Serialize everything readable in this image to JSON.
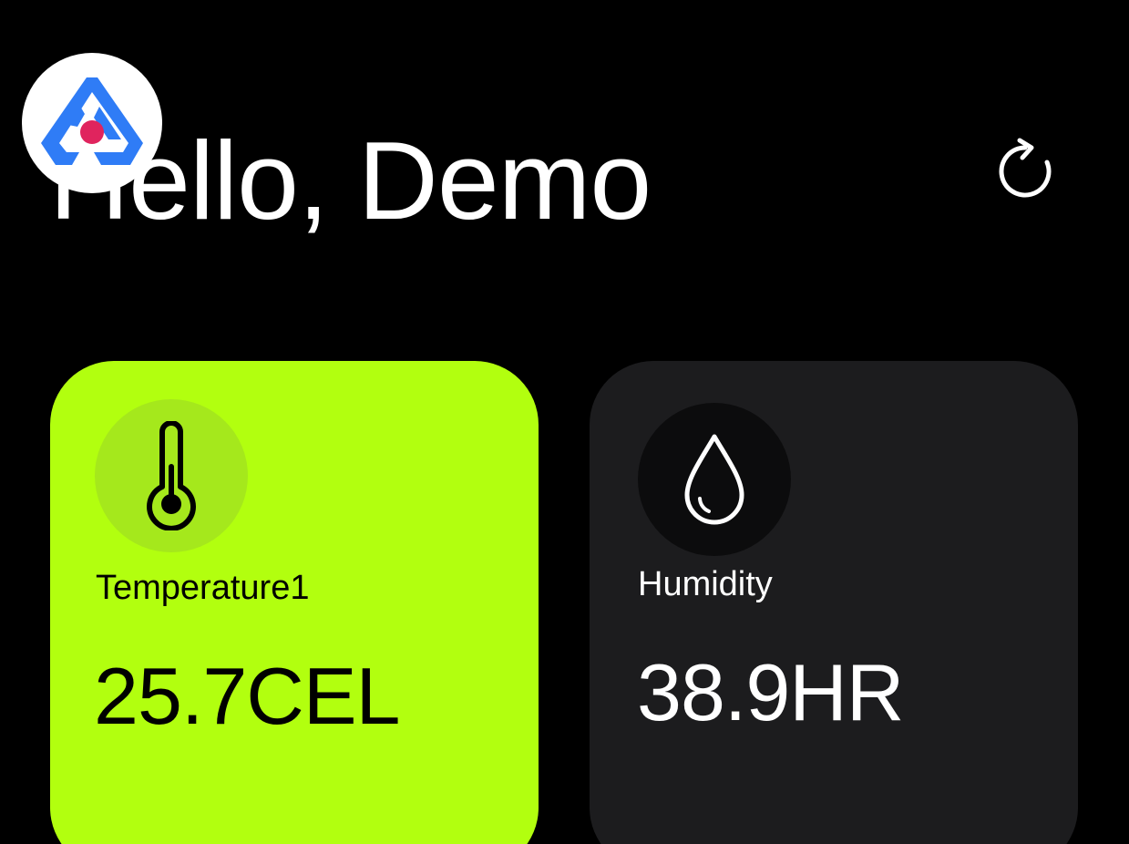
{
  "header": {
    "greeting": "Hello, Demo",
    "logo_icon": "app-logo-icon",
    "refresh_icon": "refresh-icon"
  },
  "cards": [
    {
      "icon": "thermometer-icon",
      "label": "Temperature1",
      "value": "25.7CEL",
      "background": "#b2ff0f",
      "text_color": "#000000"
    },
    {
      "icon": "water-drop-icon",
      "label": "Humidity",
      "value": "38.9HR",
      "background": "#1c1c1e",
      "text_color": "#ffffff"
    }
  ],
  "colors": {
    "background": "#000000",
    "accent": "#b2ff0f",
    "logo_blue": "#2f7cf6",
    "logo_red": "#e0245e"
  }
}
